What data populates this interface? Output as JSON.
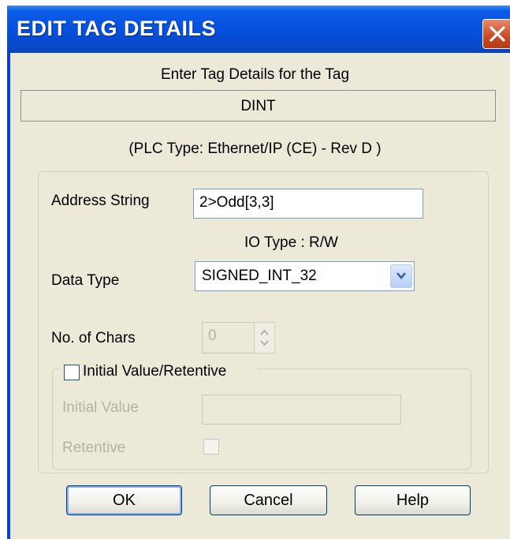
{
  "window": {
    "title": "EDIT TAG DETAILS"
  },
  "header": {
    "prompt": "Enter Tag Details for the Tag",
    "tag_type": "DINT",
    "plc_info": "(PLC Type:  Ethernet/IP (CE)  - Rev D )"
  },
  "form": {
    "address_label": "Address String",
    "address_value": "2>Odd[3,3]",
    "io_type": "IO Type : R/W",
    "data_type_label": "Data Type",
    "data_type_value": "SIGNED_INT_32",
    "num_chars_label": "No. of Chars",
    "num_chars_value": "0",
    "initial_group_label": "Initial Value/Retentive",
    "initial_value_label": "Initial Value",
    "initial_value_value": "",
    "retentive_label": "Retentive"
  },
  "buttons": {
    "ok": "OK",
    "cancel": "Cancel",
    "help": "Help"
  },
  "colors": {
    "titlebar": "#0550dc",
    "close": "#c94a24",
    "face": "#ece9d8",
    "border_blue": "#7f9db9"
  }
}
